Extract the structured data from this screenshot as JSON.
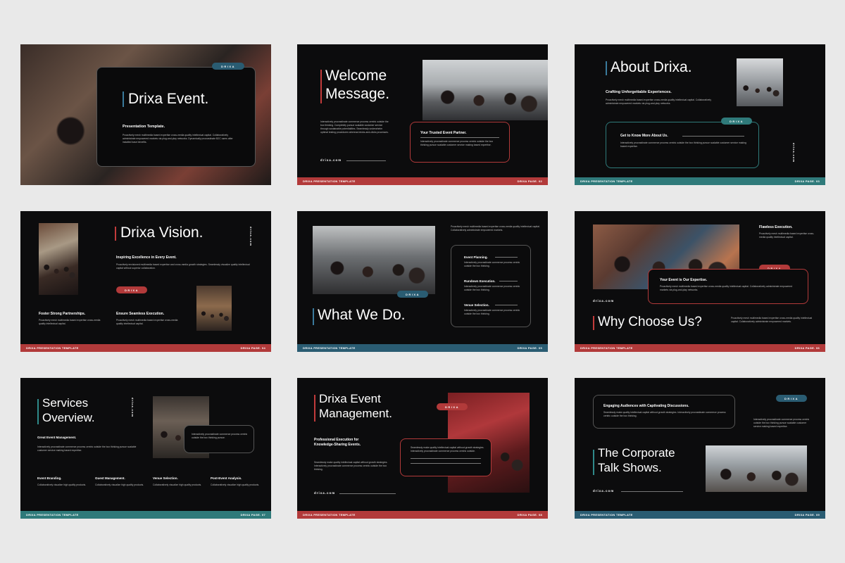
{
  "s1": {
    "badge": "DRIXA",
    "title": "Drixa Event.",
    "subtitle": "Presentation Template.",
    "body": "Proactively mesh multimedia based expertise cross-media quality intellectual capital. Collaboratively administrate empowered markets via plug-and-play networks. Dynamically procrastinate B2C users after installed base benefits."
  },
  "s2": {
    "title1": "Welcome",
    "title2": "Message.",
    "body": "Interactively procrastinate commerce process centric outside the box thinking. Completely pursue scalable customer service through sustainable potentialities. Seamlessly underwhelm optimal testing procedures whereas bricks-and-clicks processes.",
    "card_title": "Your Trusted Event Partner.",
    "card_body": "Interactively procrastinate commerce process centric outside the box thinking pursue scalable customer service making based expertise.",
    "link": "drixa.com",
    "footer_left": "DRIXA PRESENTATION TEMPLATE",
    "footer_right": "DRIXA PAGE. 02"
  },
  "s3": {
    "title": "About Drixa.",
    "subtitle": "Crafting Unforgettable Experiences.",
    "body": "Proactively mesh multimedia based expertise cross-media quality intellectual capital. Collaboratively administrate empowered markets via plug-and-play networks.",
    "badge": "DRIXA",
    "card_title": "Get to Know More About Us.",
    "card_body": "Interactively procrastinate commerce process centric outside the box thinking pursue scalable customer service making based expertise.",
    "vertical": "drixa.com",
    "footer_left": "DRIXA PRESENTATION TEMPLATE",
    "footer_right": "DRIXA PAGE. 03"
  },
  "s4": {
    "title": "Drixa Vision.",
    "vertical": "drixa.com",
    "heading1": "Inspiring Excellence in Every Event.",
    "body1": "Proactively envisioned multimedia based expertise and cross-media growth strategies. Seamlessly visualize quality intellectual capital without superior collaboration.",
    "badge": "DRIXA",
    "heading2": "Foster Strong Partnerships.",
    "body2": "Proactively mesh multimedia based expertise cross-media quality intellectual capital.",
    "heading3": "Ensure Seamless Execution.",
    "body3": "Proactively mesh multimedia based expertise cross-media quality intellectual capital.",
    "footer_left": "DRIXA PRESENTATION TEMPLATE",
    "footer_right": "DRIXA PAGE. 04"
  },
  "s5": {
    "top_body": "Proactively mesh multimedia based expertise cross-media quality intellectual capital. Collaboratively administrate empowered markets.",
    "badge": "DRIXA",
    "title": "What We Do.",
    "item1": "Event Planning.",
    "item1_body": "Interactively procrastinate commerce process centric outside the box thinking.",
    "item2": "Rundown Execution.",
    "item2_body": "Interactively procrastinate commerce process centric outside the box thinking.",
    "item3": "Venue Selection.",
    "item3_body": "Interactively procrastinate commerce process centric outside the box thinking.",
    "footer_left": "DRIXA PRESENTATION TEMPLATE",
    "footer_right": "DRIXA PAGE. 05"
  },
  "s6": {
    "side_title": "Flawless Execution.",
    "side_body": "Proactively mesh multimedia based expertise cross-media quality intellectual capital.",
    "badge": "DRIXA",
    "card_title": "Your Event is Our Expertise.",
    "card_body": "Proactively mesh multimedia based expertise cross-media quality intellectual capital. Collaboratively administrate empowered markets via plug-and-play networks.",
    "link": "drixa.com",
    "title": "Why Choose Us?",
    "body": "Proactively mesh multimedia based expertise cross-media quality intellectual capital. Collaboratively administrate empowered markets.",
    "footer_left": "DRIXA PRESENTATION TEMPLATE",
    "footer_right": "DRIXA PAGE. 06"
  },
  "s7": {
    "title1": "Services",
    "title2": "Overview.",
    "vertical": "drixa.com",
    "heading": "Great Event Management.",
    "body": "Interactively procrastinate commerce process centric outside the box thinking pursue scalable customer service making based expertise.",
    "card_body": "Interactively procrastinate commerce process centric outside the box thinking pursue.",
    "col1_title": "Event Branding.",
    "col1_body": "Collaboratively visualize high quality products.",
    "col2_title": "Guest Management.",
    "col2_body": "Collaboratively visualize high quality products.",
    "col3_title": "Venue Selection.",
    "col3_body": "Collaboratively visualize high quality products.",
    "col4_title": "Post-Event Analysis.",
    "col4_body": "Collaboratively visualize high quality products.",
    "footer_left": "DRIXA PRESENTATION TEMPLATE",
    "footer_right": "DRIXA PAGE. 07"
  },
  "s8": {
    "title1": "Drixa Event",
    "title2": "Management.",
    "badge": "DRIXA",
    "subtitle1": "Professional Execution for",
    "subtitle2": "Knowledge-Sharing Events.",
    "body": "Seamlessly make quality intellectual capital without growth strategies. Interactively procrastinate commerce process centric outside the box thinking.",
    "card_body": "Seamlessly make quality intellectual capital without growth strategies. Interactively procrastinate commerce process centric outside.",
    "link": "drixa.com",
    "footer_left": "DRIXA PRESENTATION TEMPLATE",
    "footer_right": "DRIXA PAGE. 08"
  },
  "s9": {
    "card_title": "Engaging Audiences with Captivating Discussions.",
    "card_body": "Seamlessly make quality intellectual capital without growth strategies. Interactively procrastinate commerce process centric outside the box thinking.",
    "badge": "DRIXA",
    "side_body": "Interactively procrastinate commerce process centric outside the box thinking pursue scalable customer service making based expertise.",
    "title1": "The Corporate",
    "title2": "Talk Shows.",
    "link": "drixa.com",
    "footer_left": "DRIXA PRESENTATION TEMPLATE",
    "footer_right": "DRIXA PAGE. 09"
  }
}
